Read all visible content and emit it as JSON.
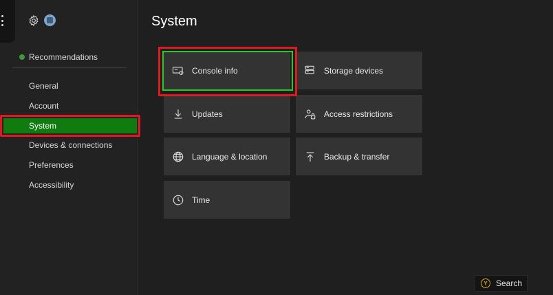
{
  "header": {
    "title": "System",
    "gear_icon": "gear-icon",
    "avatar_icon": "avatar"
  },
  "sidebar": {
    "recommendations": "Recommendations",
    "items": [
      {
        "label": "General"
      },
      {
        "label": "Account"
      },
      {
        "label": "System",
        "selected": true
      },
      {
        "label": "Devices & connections"
      },
      {
        "label": "Preferences"
      },
      {
        "label": "Accessibility"
      }
    ]
  },
  "tiles": [
    {
      "label": "Console info",
      "icon": "console-info-icon",
      "focused": true
    },
    {
      "label": "Storage devices",
      "icon": "storage-icon"
    },
    {
      "label": "Updates",
      "icon": "download-icon"
    },
    {
      "label": "Access restrictions",
      "icon": "access-restrictions-icon"
    },
    {
      "label": "Language & location",
      "icon": "globe-icon"
    },
    {
      "label": "Backup & transfer",
      "icon": "upload-icon"
    },
    {
      "label": "Time",
      "icon": "clock-icon"
    }
  ],
  "search": {
    "button_glyph": "Y",
    "label": "Search"
  },
  "colors": {
    "selected_green": "#107c10",
    "focus_green": "#22cc22",
    "highlight_red": "#e3171f",
    "y_button": "#d6a51c"
  }
}
